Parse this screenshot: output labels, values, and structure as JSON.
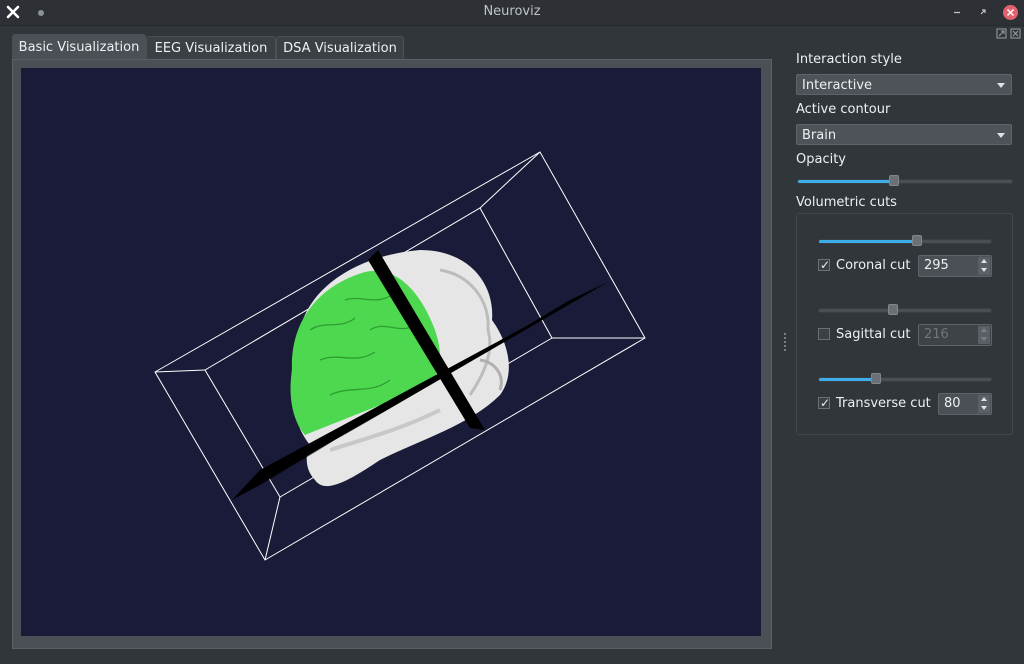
{
  "window": {
    "title": "Neuroviz",
    "accent": "#3daee9",
    "close_color": "#e0626d"
  },
  "tabs": [
    {
      "label": "Basic Visualization",
      "active": true
    },
    {
      "label": "EEG Visualization",
      "active": false
    },
    {
      "label": "DSA Visualization",
      "active": false
    }
  ],
  "viewport": {
    "background": "#1a1b38",
    "brain_color": "#4dd84f",
    "head_color": "#e6e6e6"
  },
  "panel": {
    "interaction_style": {
      "label": "Interaction style",
      "value": "Interactive"
    },
    "active_contour": {
      "label": "Active contour",
      "value": "Brain"
    },
    "opacity": {
      "label": "Opacity",
      "value": 0.45
    },
    "volumetric_cuts": {
      "label": "Volumetric cuts",
      "coronal": {
        "label": "Coronal cut",
        "checked": true,
        "value": "295",
        "slider": 0.57,
        "enabled": true
      },
      "sagittal": {
        "label": "Sagittal cut",
        "checked": false,
        "value": "216",
        "slider": 0.43,
        "enabled": false
      },
      "transverse": {
        "label": "Transverse cut",
        "checked": true,
        "value": "80",
        "slider": 0.33,
        "enabled": true
      }
    }
  }
}
